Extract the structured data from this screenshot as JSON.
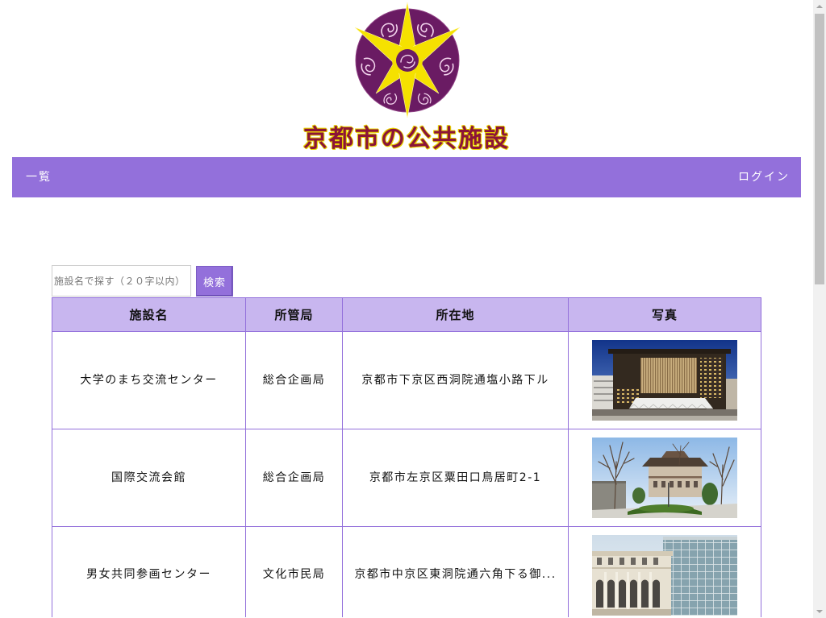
{
  "site": {
    "title": "京都市の公共施設"
  },
  "nav": {
    "list_label": "一覧",
    "login_label": "ログイン"
  },
  "search": {
    "placeholder": "施設名で探す（２０字以内）",
    "value": "",
    "button_label": "検索"
  },
  "table": {
    "headers": {
      "name": "施設名",
      "bureau": "所管局",
      "address": "所在地",
      "photo": "写真"
    },
    "rows": [
      {
        "name": "大学のまち交流センター",
        "bureau": "総合企画局",
        "address": "京都市下京区西洞院通塩小路下ル"
      },
      {
        "name": "国際交流会館",
        "bureau": "総合企画局",
        "address": "京都市左京区粟田口鳥居町2-1"
      },
      {
        "name": "男女共同参画センター",
        "bureau": "文化市民局",
        "address": "京都市中京区東洞院通六角下る御..."
      }
    ]
  },
  "icons": {
    "emblem": "kyoto-city-emblem-icon",
    "scroll_up": "arrow-up-icon",
    "scroll_down": "arrow-down-icon"
  },
  "colors": {
    "accent": "#9370db",
    "header_background": "#c8b6ef",
    "title_text": "#8b1538",
    "title_outline": "#e8d200",
    "emblem_purple": "#6a1b63",
    "emblem_yellow": "#f5e100"
  }
}
